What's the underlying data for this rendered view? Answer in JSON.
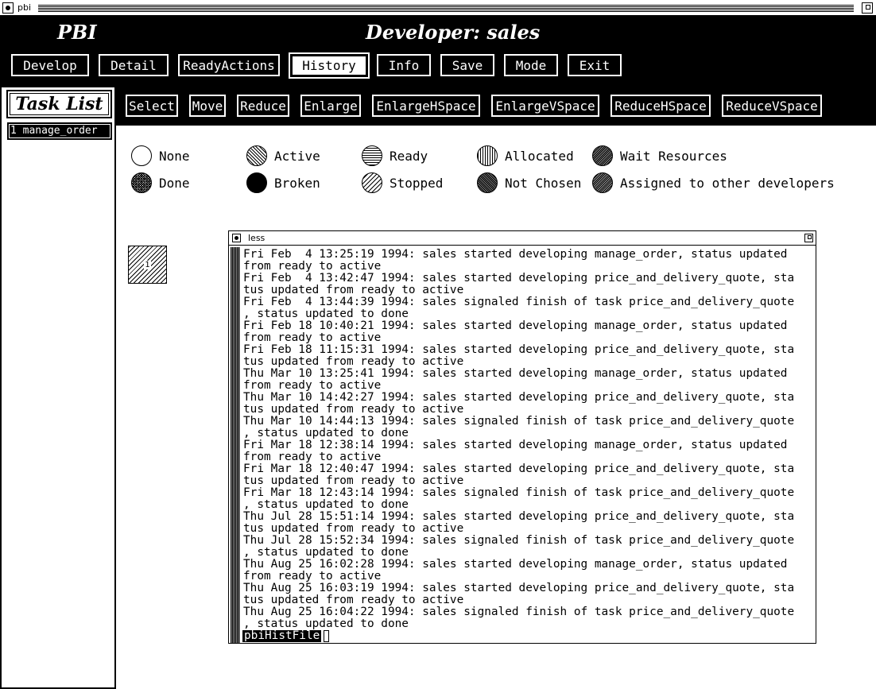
{
  "window": {
    "title": "pbi"
  },
  "header": {
    "app_name": "PBI",
    "developer_title": "Developer: sales"
  },
  "menu": {
    "develop": "Develop",
    "detail": "Detail",
    "ready_actions": "ReadyActions",
    "history": "History",
    "info": "Info",
    "save": "Save",
    "mode": "Mode",
    "exit": "Exit",
    "active_item": "History"
  },
  "task_list": {
    "title": "Task List",
    "items": [
      {
        "label": "1 manage_order"
      }
    ]
  },
  "toolbar": {
    "select": "Select",
    "move": "Move",
    "reduce": "Reduce",
    "enlarge": "Enlarge",
    "enlarge_h": "EnlargeHSpace",
    "enlarge_v": "EnlargeVSpace",
    "reduce_h": "ReduceHSpace",
    "reduce_v": "ReduceVSpace"
  },
  "legend": {
    "none": "None",
    "active": "Active",
    "ready": "Ready",
    "allocated": "Allocated",
    "wait_resources": "Wait Resources",
    "done": "Done",
    "broken": "Broken",
    "stopped": "Stopped",
    "not_chosen": "Not Chosen",
    "assigned": "Assigned to other developers"
  },
  "task_node": {
    "label": "1"
  },
  "less_window": {
    "title": "less",
    "lines": [
      "Fri Feb  4 13:25:19 1994: sales started developing manage_order, status updated",
      "from ready to active",
      "Fri Feb  4 13:42:47 1994: sales started developing price_and_delivery_quote, sta",
      "tus updated from ready to active",
      "Fri Feb  4 13:44:39 1994: sales signaled finish of task price_and_delivery_quote",
      ", status updated to done",
      "Fri Feb 18 10:40:21 1994: sales started developing manage_order, status updated",
      "from ready to active",
      "Fri Feb 18 11:15:31 1994: sales started developing price_and_delivery_quote, sta",
      "tus updated from ready to active",
      "Thu Mar 10 13:25:41 1994: sales started developing manage_order, status updated",
      "from ready to active",
      "Thu Mar 10 14:42:27 1994: sales started developing price_and_delivery_quote, sta",
      "tus updated from ready to active",
      "Thu Mar 10 14:44:13 1994: sales signaled finish of task price_and_delivery_quote",
      ", status updated to done",
      "Fri Mar 18 12:38:14 1994: sales started developing manage_order, status updated",
      "from ready to active",
      "Fri Mar 18 12:40:47 1994: sales started developing price_and_delivery_quote, sta",
      "tus updated from ready to active",
      "Fri Mar 18 12:43:14 1994: sales signaled finish of task price_and_delivery_quote",
      ", status updated to done",
      "Thu Jul 28 15:51:14 1994: sales started developing price_and_delivery_quote, sta",
      "tus updated from ready to active",
      "Thu Jul 28 15:52:34 1994: sales signaled finish of task price_and_delivery_quote",
      ", status updated to done",
      "Thu Aug 25 16:02:28 1994: sales started developing manage_order, status updated",
      "from ready to active",
      "Thu Aug 25 16:03:19 1994: sales started developing price_and_delivery_quote, sta",
      "tus updated from ready to active",
      "Thu Aug 25 16:04:22 1994: sales signaled finish of task price_and_delivery_quote",
      ", status updated to done"
    ],
    "prompt": "pbiHistFile"
  }
}
